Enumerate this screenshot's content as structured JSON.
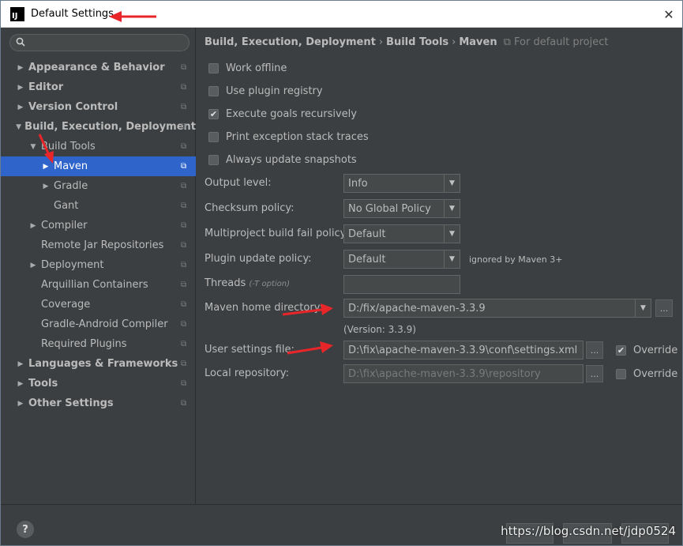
{
  "window": {
    "title": "Default Settings",
    "logo": "IJ",
    "close_glyph": "✕"
  },
  "search": {
    "placeholder": "",
    "icon": "search-icon"
  },
  "tree": [
    {
      "label": "Appearance & Behavior",
      "level": 0,
      "expandable": true,
      "expanded": false,
      "bold": true
    },
    {
      "label": "Editor",
      "level": 0,
      "expandable": true,
      "expanded": false,
      "bold": true
    },
    {
      "label": "Version Control",
      "level": 0,
      "expandable": true,
      "expanded": false,
      "bold": true
    },
    {
      "label": "Build, Execution, Deployment",
      "level": 0,
      "expandable": true,
      "expanded": true,
      "bold": true
    },
    {
      "label": "Build Tools",
      "level": 1,
      "expandable": true,
      "expanded": true,
      "bold": false
    },
    {
      "label": "Maven",
      "level": 2,
      "expandable": true,
      "expanded": false,
      "bold": false,
      "selected": true
    },
    {
      "label": "Gradle",
      "level": 2,
      "expandable": true,
      "expanded": false,
      "bold": false
    },
    {
      "label": "Gant",
      "level": 2,
      "expandable": false,
      "bold": false
    },
    {
      "label": "Compiler",
      "level": 1,
      "expandable": true,
      "expanded": false,
      "bold": false
    },
    {
      "label": "Remote Jar Repositories",
      "level": 1,
      "expandable": false,
      "bold": false
    },
    {
      "label": "Deployment",
      "level": 1,
      "expandable": true,
      "expanded": false,
      "bold": false
    },
    {
      "label": "Arquillian Containers",
      "level": 1,
      "expandable": false,
      "bold": false
    },
    {
      "label": "Coverage",
      "level": 1,
      "expandable": false,
      "bold": false
    },
    {
      "label": "Gradle-Android Compiler",
      "level": 1,
      "expandable": false,
      "bold": false
    },
    {
      "label": "Required Plugins",
      "level": 1,
      "expandable": false,
      "bold": false
    },
    {
      "label": "Languages & Frameworks",
      "level": 0,
      "expandable": true,
      "expanded": false,
      "bold": true
    },
    {
      "label": "Tools",
      "level": 0,
      "expandable": true,
      "expanded": false,
      "bold": true
    },
    {
      "label": "Other Settings",
      "level": 0,
      "expandable": true,
      "expanded": false,
      "bold": true
    }
  ],
  "breadcrumb": {
    "parts": [
      "Build, Execution, Deployment",
      "Build Tools",
      "Maven"
    ],
    "separator": "›",
    "scope": "For default project"
  },
  "checkboxes": [
    {
      "label": "Work offline",
      "checked": false
    },
    {
      "label": "Use plugin registry",
      "checked": false
    },
    {
      "label": "Execute goals recursively",
      "checked": true
    },
    {
      "label": "Print exception stack traces",
      "checked": false
    },
    {
      "label": "Always update snapshots",
      "checked": false
    }
  ],
  "form": {
    "output_level": {
      "label": "Output level:",
      "value": "Info"
    },
    "checksum_policy": {
      "label": "Checksum policy:",
      "value": "No Global Policy"
    },
    "multiproject_policy": {
      "label": "Multiproject build fail policy:",
      "value": "Default"
    },
    "plugin_update_policy": {
      "label": "Plugin update policy:",
      "value": "Default",
      "note": "ignored by Maven 3+"
    },
    "threads": {
      "label": "Threads",
      "hint": "(-T option)",
      "value": ""
    },
    "maven_home": {
      "label": "Maven home directory:",
      "value": "D:/fix/apache-maven-3.3.9",
      "version": "(Version: 3.3.9)"
    },
    "user_settings": {
      "label": "User settings file:",
      "value": "D:\\fix\\apache-maven-3.3.9\\conf\\settings.xml",
      "override_label": "Override",
      "override_checked": true
    },
    "local_repo": {
      "label": "Local repository:",
      "value": "D:\\fix\\apache-maven-3.3.9\\repository",
      "override_label": "Override",
      "override_checked": false
    },
    "browse_glyph": "..."
  },
  "footer": {
    "help": "?",
    "watermark": "https://blog.csdn.net/jdp0524"
  },
  "colors": {
    "annotation": "#e8262a",
    "selection": "#2f65ca",
    "panel": "#3c3f41"
  }
}
